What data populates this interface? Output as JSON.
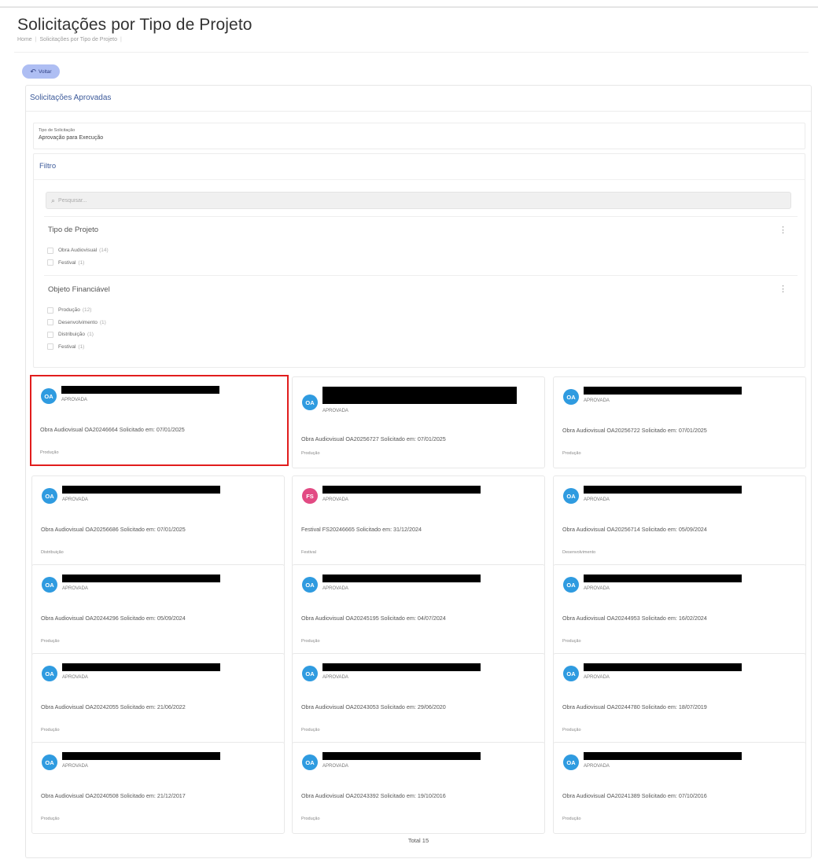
{
  "page": {
    "title": "Solicitações por Tipo de Projeto",
    "breadcrumb": [
      "Home",
      "Solicitações por Tipo de Projeto"
    ]
  },
  "back_button": {
    "label": "Voltar",
    "icon": "reply-arrow-icon"
  },
  "panel": {
    "title": "Solicitações Aprovadas"
  },
  "request_type": {
    "label": "Tipo de Solicitação",
    "value": "Aprovação para Execução"
  },
  "filter": {
    "title": "Filtro",
    "search_placeholder": "Pesquisar...",
    "groups": [
      {
        "title": "Tipo de Projeto",
        "items": [
          {
            "label": "Obra Audiovisual",
            "count": "(14)"
          },
          {
            "label": "Festival",
            "count": "(1)"
          }
        ]
      },
      {
        "title": "Objeto Financiável",
        "items": [
          {
            "label": "Produção",
            "count": "(12)"
          },
          {
            "label": "Desenvolvimento",
            "count": "(1)"
          },
          {
            "label": "Distribuição",
            "count": "(1)"
          },
          {
            "label": "Festival",
            "count": "(1)"
          }
        ]
      }
    ]
  },
  "colors": {
    "oa_avatar": "#2f9be0",
    "fs_avatar": "#e24a83",
    "highlight": "#e11d1d",
    "accent": "#3c5a9a"
  },
  "cards": [
    {
      "avatar": "OA",
      "status": "APROVADA",
      "description": "Obra Audiovisual OA20246664 Solicitado em: 07/01/2025",
      "tag": "Produção"
    },
    {
      "avatar": "OA",
      "status": "APROVADA",
      "description": "Obra Audiovisual OA20256727 Solicitado em: 07/01/2025",
      "tag": "Produção"
    },
    {
      "avatar": "OA",
      "status": "APROVADA",
      "description": "Obra Audiovisual OA20256722 Solicitado em: 07/01/2025",
      "tag": "Produção"
    },
    {
      "avatar": "OA",
      "status": "APROVADA",
      "description": "Obra Audiovisual OA20256686 Solicitado em: 07/01/2025",
      "tag": "Distribuição"
    },
    {
      "avatar": "FS",
      "status": "APROVADA",
      "description": "Festival FS20246665 Solicitado em: 31/12/2024",
      "tag": "Festival"
    },
    {
      "avatar": "OA",
      "status": "APROVADA",
      "description": "Obra Audiovisual OA20256714 Solicitado em: 05/09/2024",
      "tag": "Desenvolvimento"
    },
    {
      "avatar": "OA",
      "status": "APROVADA",
      "description": "Obra Audiovisual OA20244296 Solicitado em: 05/09/2024",
      "tag": "Produção"
    },
    {
      "avatar": "OA",
      "status": "APROVADA",
      "description": "Obra Audiovisual OA20245195 Solicitado em: 04/07/2024",
      "tag": "Produção"
    },
    {
      "avatar": "OA",
      "status": "APROVADA",
      "description": "Obra Audiovisual OA20244953 Solicitado em: 16/02/2024",
      "tag": "Produção"
    },
    {
      "avatar": "OA",
      "status": "APROVADA",
      "description": "Obra Audiovisual OA20242055 Solicitado em: 21/06/2022",
      "tag": "Produção"
    },
    {
      "avatar": "OA",
      "status": "APROVADA",
      "description": "Obra Audiovisual OA20243053 Solicitado em: 29/06/2020",
      "tag": "Produção"
    },
    {
      "avatar": "OA",
      "status": "APROVADA",
      "description": "Obra Audiovisual OA20244780 Solicitado em: 18/07/2019",
      "tag": "Produção"
    },
    {
      "avatar": "OA",
      "status": "APROVADA",
      "description": "Obra Audiovisual OA20240508 Solicitado em: 21/12/2017",
      "tag": "Produção"
    },
    {
      "avatar": "OA",
      "status": "APROVADA",
      "description": "Obra Audiovisual OA20243392 Solicitado em: 19/10/2016",
      "tag": "Produção"
    },
    {
      "avatar": "OA",
      "status": "APROVADA",
      "description": "Obra Audiovisual OA20241389 Solicitado em: 07/10/2016",
      "tag": "Produção"
    }
  ],
  "total": "Total 15"
}
